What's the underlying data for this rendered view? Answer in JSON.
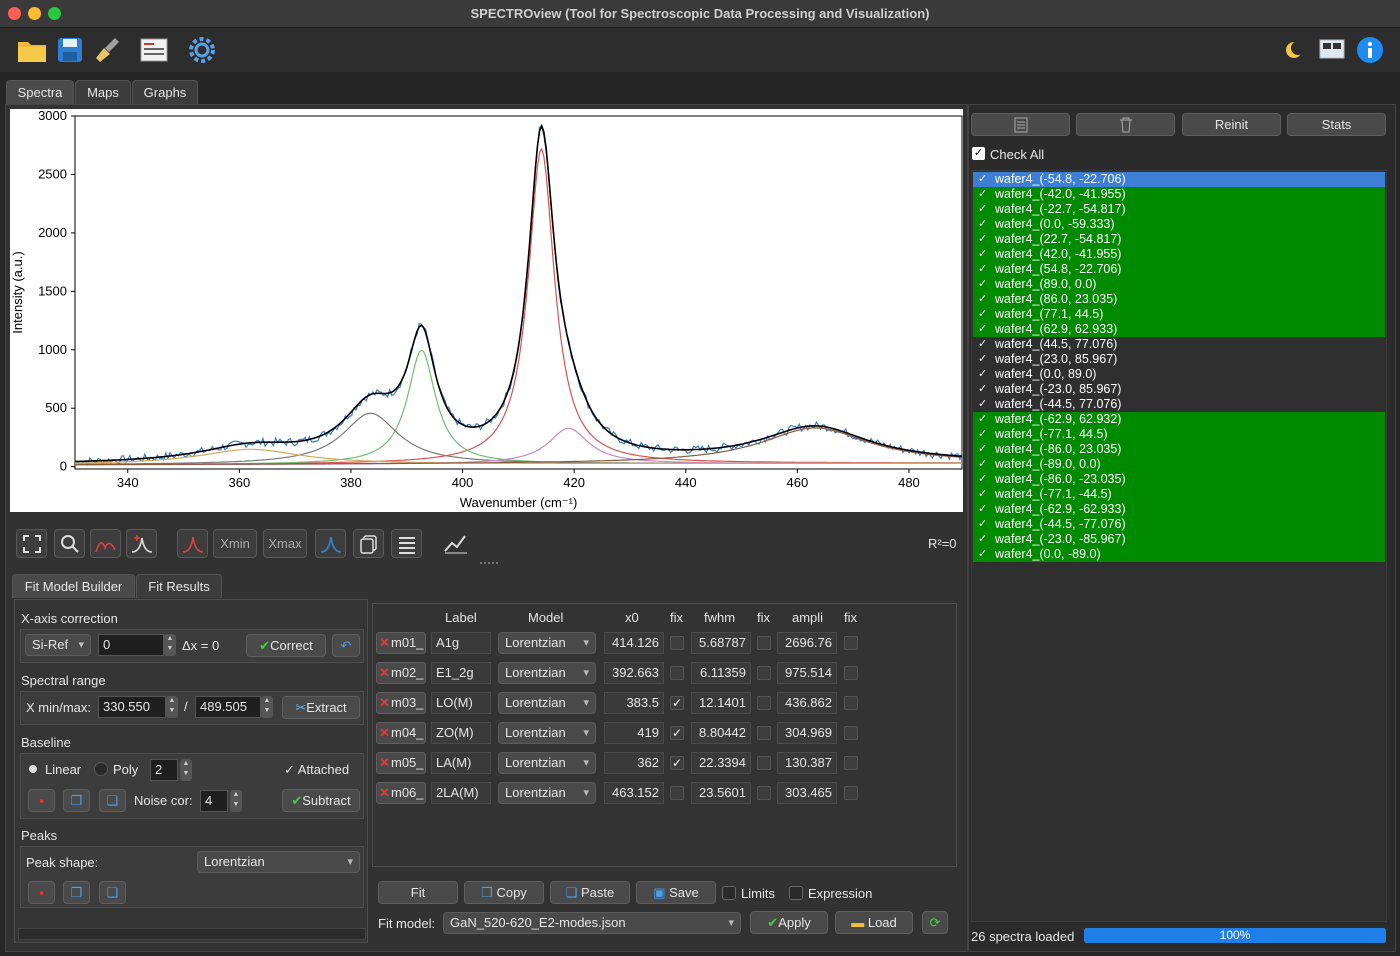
{
  "window": {
    "title": "SPECTROview (Tool for Spectroscopic Data Processing and Visualization)"
  },
  "toolbar": {
    "icons": [
      "open-folder-icon",
      "save-icon",
      "clear-broom-icon",
      "report-icon",
      "settings-gear-icon",
      "theme-toggle-icon",
      "about-screen-icon",
      "info-icon"
    ]
  },
  "tabs": [
    "Spectra",
    "Maps",
    "Graphs"
  ],
  "chart_data": {
    "type": "line",
    "xlabel": "Wavenumber (cm⁻¹)",
    "ylabel": "Intensity (a.u.)",
    "xlim": [
      330.55,
      489.505
    ],
    "ylim": [
      -20,
      3000
    ],
    "x_ticks": [
      340,
      360,
      380,
      400,
      420,
      440,
      460,
      480
    ],
    "y_ticks": [
      0,
      500,
      1000,
      1500,
      2000,
      2500,
      3000
    ],
    "peaks": [
      {
        "name": "A1g",
        "x0": 414.126,
        "fwhm": 5.68787,
        "ampli": 2696.76,
        "color": "#d6534f"
      },
      {
        "name": "E1_2g",
        "x0": 392.663,
        "fwhm": 6.11359,
        "ampli": 975.514,
        "color": "#6fbf6f"
      },
      {
        "name": "LO(M)",
        "x0": 383.5,
        "fwhm": 12.1401,
        "ampli": 436.862,
        "color": "#7a7a7a"
      },
      {
        "name": "ZO(M)",
        "x0": 419,
        "fwhm": 8.80442,
        "ampli": 304.969,
        "color": "#c98ac9"
      },
      {
        "name": "LA(M)",
        "x0": 362,
        "fwhm": 22.3394,
        "ampli": 130.387,
        "color": "#d2a95a"
      },
      {
        "name": "2LA(M)",
        "x0": 463.152,
        "fwhm": 23.5601,
        "ampli": 303.465,
        "color": "#8a5a3c"
      }
    ],
    "baseline": {
      "start": 15,
      "end": 30
    },
    "colors": {
      "raw": "#3a7ebf",
      "fit": "#000000"
    }
  },
  "plot_toolbar": {
    "xmin_label": "Xmin",
    "xmax_label": "Xmax",
    "r2": "R²=0"
  },
  "fit_tabs": [
    "Fit Model Builder",
    "Fit Results"
  ],
  "xcorr": {
    "title": "X-axis correction",
    "ref": "Si-Ref",
    "value": "0",
    "delta": "Δx = 0",
    "correct": "Correct"
  },
  "range": {
    "title": "Spectral range",
    "label": "X min/max:",
    "xmin": "330.550",
    "sep": "/",
    "xmax": "489.505",
    "extract": "Extract"
  },
  "baseline_ui": {
    "title": "Baseline",
    "linear": "Linear",
    "poly": "Poly",
    "poly_order": "2",
    "attached": "Attached",
    "noise_label": "Noise cor:",
    "noise": "4",
    "subtract": "Subtract"
  },
  "peaks_ui": {
    "title": "Peaks",
    "shape_label": "Peak shape:",
    "shape": "Lorentzian"
  },
  "table": {
    "headers": {
      "label": "Label",
      "model": "Model",
      "x0": "x0",
      "fix": "fix",
      "fwhm": "fwhm",
      "ampli": "ampli"
    },
    "rows": [
      {
        "id": "m01_",
        "label": "A1g",
        "model": "Lorentzian",
        "x0": "414.126",
        "x0fix": false,
        "fwhm": "5.68787",
        "fwhmfix": false,
        "ampli": "2696.76"
      },
      {
        "id": "m02_",
        "label": "E1_2g",
        "model": "Lorentzian",
        "x0": "392.663",
        "x0fix": false,
        "fwhm": "6.11359",
        "fwhmfix": false,
        "ampli": "975.514"
      },
      {
        "id": "m03_",
        "label": "LO(M)",
        "model": "Lorentzian",
        "x0": "383.5",
        "x0fix": true,
        "fwhm": "12.1401",
        "fwhmfix": false,
        "ampli": "436.862"
      },
      {
        "id": "m04_",
        "label": "ZO(M)",
        "model": "Lorentzian",
        "x0": "419",
        "x0fix": true,
        "fwhm": "8.80442",
        "fwhmfix": false,
        "ampli": "304.969"
      },
      {
        "id": "m05_",
        "label": "LA(M)",
        "model": "Lorentzian",
        "x0": "362",
        "x0fix": true,
        "fwhm": "22.3394",
        "fwhmfix": false,
        "ampli": "130.387"
      },
      {
        "id": "m06_",
        "label": "2LA(M)",
        "model": "Lorentzian",
        "x0": "463.152",
        "x0fix": false,
        "fwhm": "23.5601",
        "fwhmfix": false,
        "ampli": "303.465"
      }
    ]
  },
  "fit_actions": {
    "fit": "Fit",
    "copy": "Copy",
    "paste": "Paste",
    "save": "Save",
    "limits": "Limits",
    "expression": "Expression",
    "model_label": "Fit model:",
    "model": "GaN_520-620_E2-modes.json",
    "apply": "Apply",
    "load": "Load"
  },
  "right": {
    "reinit": "Reinit",
    "stats": "Stats",
    "check_all": "Check All",
    "status": "26 spectra loaded",
    "progress": "100%",
    "progress_value": 1.0
  },
  "spectra": [
    {
      "name": "wafer4_(-54.8, -22.706)",
      "state": "sel"
    },
    {
      "name": "wafer4_(-42.0, -41.955)",
      "state": "green"
    },
    {
      "name": "wafer4_(-22.7, -54.817)",
      "state": "green"
    },
    {
      "name": "wafer4_(0.0, -59.333)",
      "state": "green"
    },
    {
      "name": "wafer4_(22.7, -54.817)",
      "state": "green"
    },
    {
      "name": "wafer4_(42.0, -41.955)",
      "state": "green"
    },
    {
      "name": "wafer4_(54.8, -22.706)",
      "state": "green"
    },
    {
      "name": "wafer4_(89.0, 0.0)",
      "state": "green"
    },
    {
      "name": "wafer4_(86.0, 23.035)",
      "state": "green"
    },
    {
      "name": "wafer4_(77.1, 44.5)",
      "state": "green"
    },
    {
      "name": "wafer4_(62.9, 62.933)",
      "state": "green"
    },
    {
      "name": "wafer4_(44.5, 77.076)",
      "state": "plain"
    },
    {
      "name": "wafer4_(23.0, 85.967)",
      "state": "plain"
    },
    {
      "name": "wafer4_(0.0, 89.0)",
      "state": "plain"
    },
    {
      "name": "wafer4_(-23.0, 85.967)",
      "state": "plain"
    },
    {
      "name": "wafer4_(-44.5, 77.076)",
      "state": "plain"
    },
    {
      "name": "wafer4_(-62.9, 62.932)",
      "state": "green"
    },
    {
      "name": "wafer4_(-77.1, 44.5)",
      "state": "green"
    },
    {
      "name": "wafer4_(-86.0, 23.035)",
      "state": "green"
    },
    {
      "name": "wafer4_(-89.0, 0.0)",
      "state": "green"
    },
    {
      "name": "wafer4_(-86.0, -23.035)",
      "state": "green"
    },
    {
      "name": "wafer4_(-77.1, -44.5)",
      "state": "green"
    },
    {
      "name": "wafer4_(-62.9, -62.933)",
      "state": "green"
    },
    {
      "name": "wafer4_(-44.5, -77.076)",
      "state": "green"
    },
    {
      "name": "wafer4_(-23.0, -85.967)",
      "state": "green"
    },
    {
      "name": "wafer4_(0.0, -89.0)",
      "state": "green"
    }
  ]
}
